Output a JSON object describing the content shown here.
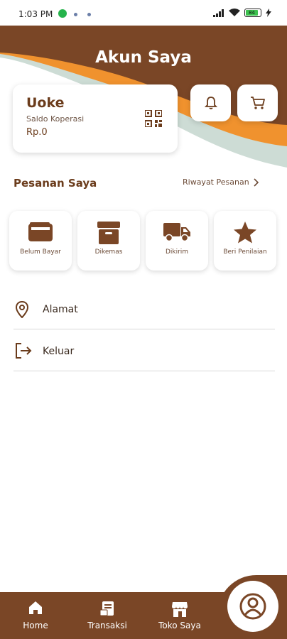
{
  "status_bar": {
    "time": "1:03 PM",
    "battery": "84"
  },
  "header": {
    "title": "Akun Saya"
  },
  "account": {
    "name": "Uoke",
    "saldo_label": "Saldo Koperasi",
    "saldo_value": "Rp.0",
    "qr_icon": "qr-code-icon"
  },
  "header_buttons": [
    {
      "name": "notification",
      "icon": "bell-icon"
    },
    {
      "name": "cart",
      "icon": "cart-icon"
    }
  ],
  "orders": {
    "title": "Pesanan Saya",
    "history_label": "Riwayat Pesanan",
    "items": [
      {
        "label": "Belum Bayar",
        "icon": "wallet-icon"
      },
      {
        "label": "Dikemas",
        "icon": "box-icon"
      },
      {
        "label": "Dikirim",
        "icon": "truck-icon"
      },
      {
        "label": "Beri Penilaian",
        "icon": "star-icon"
      }
    ]
  },
  "menu": [
    {
      "label": "Alamat",
      "icon": "location-pin-icon"
    },
    {
      "label": "Keluar",
      "icon": "logout-icon"
    }
  ],
  "bottom_nav": [
    {
      "label": "Home",
      "icon": "home-icon"
    },
    {
      "label": "Transaksi",
      "icon": "receipt-icon"
    },
    {
      "label": "Toko Saya",
      "icon": "store-icon"
    }
  ],
  "profile_icon": "profile-icon",
  "colors": {
    "brand_brown": "#7a4626",
    "accent_orange": "#f0922e",
    "accent_sage": "#c4d6ce",
    "text_brown": "#6b3c1c"
  }
}
